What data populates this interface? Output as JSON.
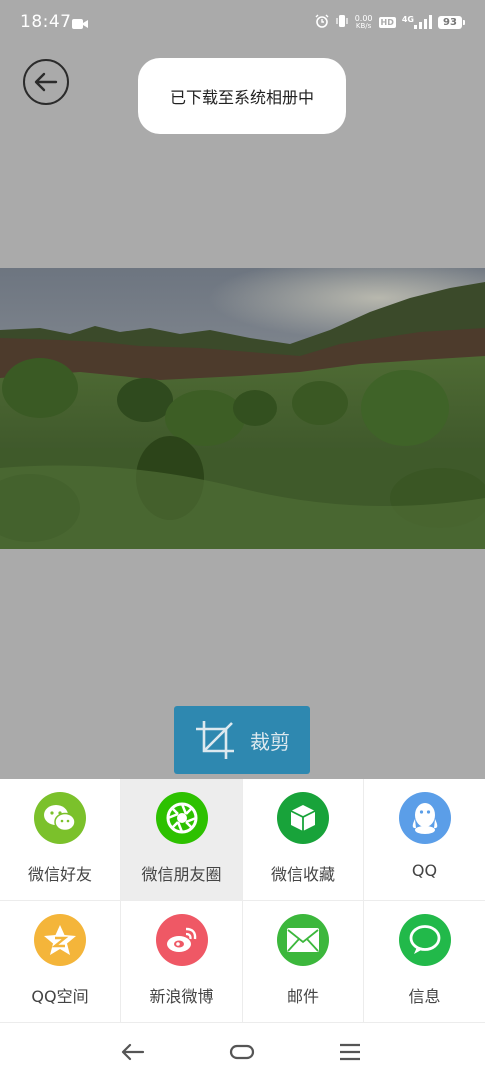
{
  "status_bar": {
    "time": "18:47",
    "speed_value": "0.00",
    "speed_unit": "KB/s",
    "hd": "HD",
    "network": "4G",
    "battery": "93",
    "icons": [
      "video-icon",
      "alarm-icon",
      "vibrate-icon",
      "signal-icon",
      "battery-icon"
    ]
  },
  "toast": {
    "text": "已下载至系统相册中"
  },
  "photo": {
    "description_icon": "landscape-photo"
  },
  "crop": {
    "label": "裁剪",
    "icon": "crop-icon"
  },
  "share": {
    "items": [
      {
        "label": "微信好友",
        "icon": "wechat-icon",
        "color": "#7bc12b"
      },
      {
        "label": "微信朋友圈",
        "icon": "moments-icon",
        "color": "#2dc100"
      },
      {
        "label": "微信收藏",
        "icon": "favorites-cube-icon",
        "color": "#18a33a"
      },
      {
        "label": "QQ",
        "icon": "qq-penguin-icon",
        "color": "#5b9ee8"
      },
      {
        "label": "QQ空间",
        "icon": "qzone-star-icon",
        "color": "#f4b53a"
      },
      {
        "label": "新浪微博",
        "icon": "weibo-icon",
        "color": "#ef5865"
      },
      {
        "label": "邮件",
        "icon": "mail-icon",
        "color": "#3cb73c"
      },
      {
        "label": "信息",
        "icon": "message-icon",
        "color": "#22b94a"
      }
    ]
  },
  "nav": {
    "icons": [
      "back-arrow-icon",
      "home-icon",
      "menu-icon"
    ]
  }
}
